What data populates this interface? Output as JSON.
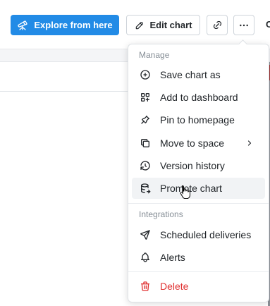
{
  "toolbar": {
    "explore_label": "Explore from here",
    "edit_label": "Edit chart",
    "cut_text": "C"
  },
  "menu": {
    "manage_label": "Manage",
    "items": [
      {
        "label": "Save chart as",
        "icon": "circle-plus-icon"
      },
      {
        "label": "Add to dashboard",
        "icon": "layout-grid-add-icon"
      },
      {
        "label": "Pin to homepage",
        "icon": "pin-icon"
      },
      {
        "label": "Move to space",
        "icon": "copy-icon"
      },
      {
        "label": "Version history",
        "icon": "history-icon"
      },
      {
        "label": "Promote chart",
        "icon": "database-export-icon"
      }
    ],
    "integrations_label": "Integrations",
    "integration_items": [
      {
        "label": "Scheduled deliveries",
        "icon": "send-icon"
      },
      {
        "label": "Alerts",
        "icon": "bell-icon"
      }
    ],
    "delete_label": "Delete"
  },
  "colors": {
    "accent": "#228be6",
    "danger": "#e03131",
    "muted": "#868e96",
    "hover": "#f1f3f5"
  }
}
